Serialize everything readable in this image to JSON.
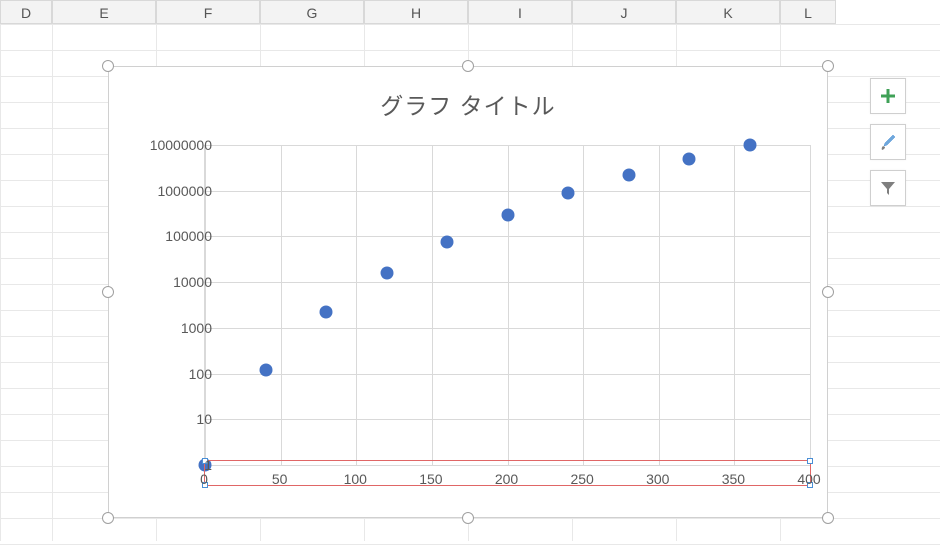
{
  "columns": [
    "D",
    "E",
    "F",
    "G",
    "H",
    "I",
    "J",
    "K",
    "L"
  ],
  "chart": {
    "title": "グラフ タイトル",
    "y_ticks": [
      "1",
      "10",
      "100",
      "1000",
      "10000",
      "100000",
      "1000000",
      "10000000"
    ],
    "x_ticks": [
      "0",
      "50",
      "100",
      "150",
      "200",
      "250",
      "300",
      "350",
      "400"
    ]
  },
  "chart_data": {
    "type": "scatter",
    "title": "グラフ タイトル",
    "xlabel": "",
    "ylabel": "",
    "x_range": [
      0,
      400
    ],
    "y_range_log10": [
      0,
      7
    ],
    "y_scale": "log",
    "x": [
      0,
      40,
      80,
      120,
      160,
      200,
      240,
      280,
      320,
      360
    ],
    "y": [
      1,
      120,
      2200,
      16000,
      75000,
      300000,
      900000,
      2200000,
      5000000,
      10000000
    ]
  },
  "tools": {
    "add": "chart-elements",
    "style": "chart-styles",
    "filter": "chart-filters"
  }
}
